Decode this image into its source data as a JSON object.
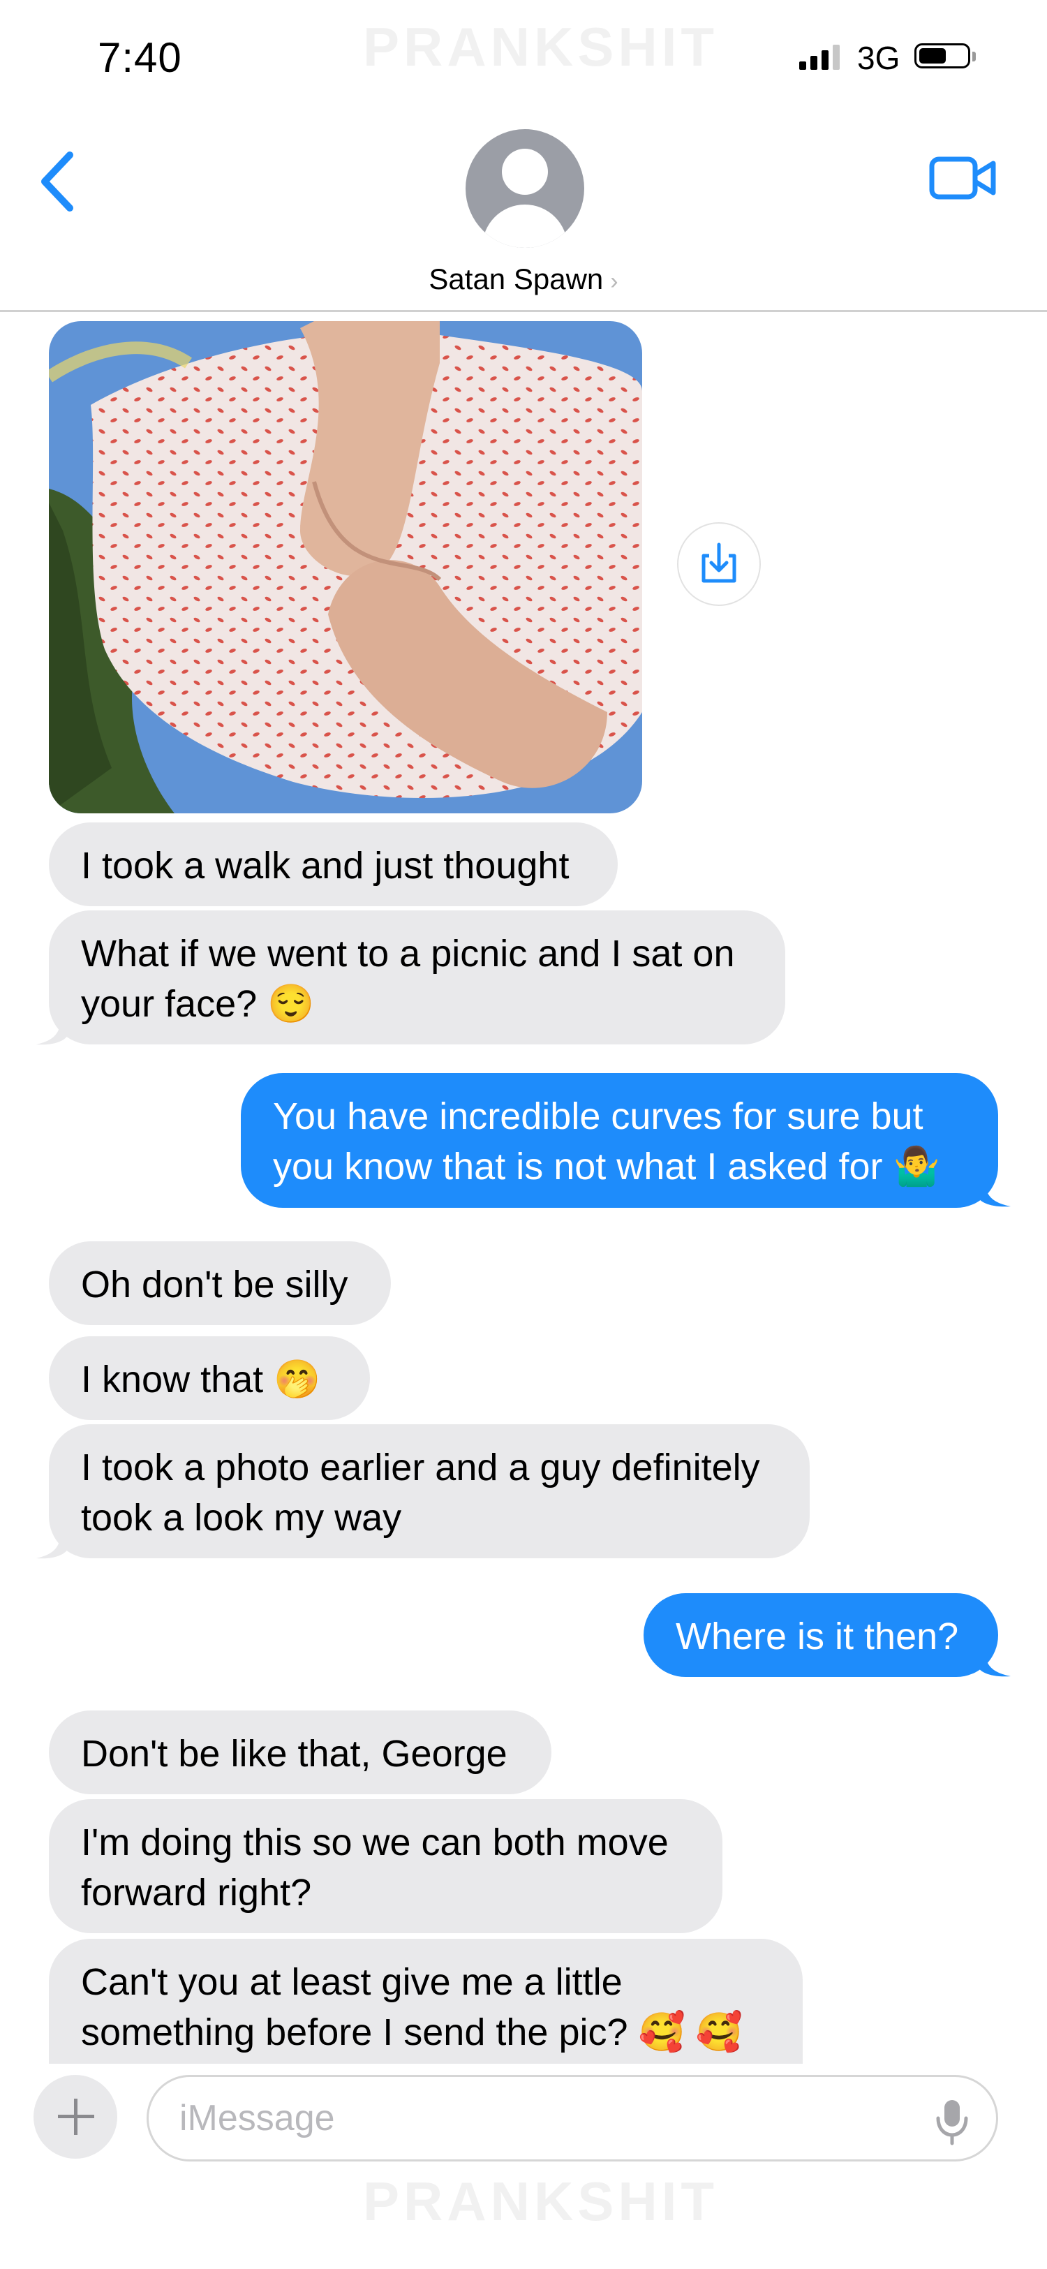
{
  "status_bar": {
    "time": "7:40",
    "network": "3G",
    "watermark": "PRANKSHIT"
  },
  "header": {
    "contact_name": "Satan Spawn",
    "back_icon": "chevron-left-icon",
    "video_icon": "video-camera-icon",
    "avatar_icon": "person-icon"
  },
  "colors": {
    "accent": "#1e8cfb",
    "incoming_bubble": "#e9e9eb"
  },
  "messages": [
    {
      "from": "them",
      "type": "image"
    },
    {
      "from": "them",
      "lines": [
        "I took a walk and just thought"
      ]
    },
    {
      "from": "them",
      "lines": [
        "What if we went to a picnic and I sat on",
        "your face? 😌"
      ]
    },
    {
      "from": "me",
      "lines": [
        "You have incredible curves for sure but",
        "you know that is not what I asked for 🤷‍♂️"
      ]
    },
    {
      "from": "them",
      "lines": [
        "Oh don't be silly"
      ]
    },
    {
      "from": "them",
      "lines": [
        "I know that 🤭"
      ]
    },
    {
      "from": "them",
      "lines": [
        "I took a photo earlier and a guy definitely",
        "took a look my way"
      ]
    },
    {
      "from": "me",
      "lines": [
        "Where is it then?"
      ]
    },
    {
      "from": "them",
      "lines": [
        "Don't be like that, George"
      ]
    },
    {
      "from": "them",
      "lines": [
        "I'm doing this so we can both move",
        "forward right?"
      ]
    },
    {
      "from": "them",
      "lines": [
        "Can't you at least give me a little",
        "something before I send the pic? 🥰 🥰"
      ]
    }
  ],
  "composer": {
    "placeholder": "iMessage",
    "add_icon": "plus-icon",
    "mic_icon": "microphone-icon"
  }
}
